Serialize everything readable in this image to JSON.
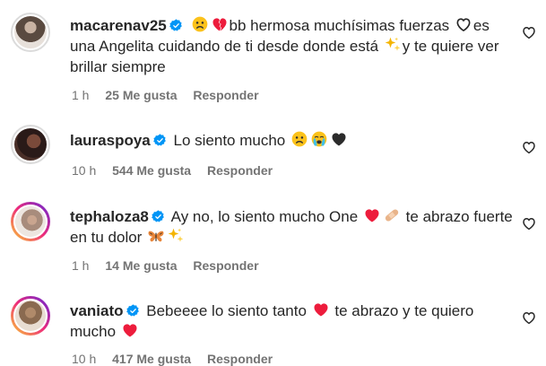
{
  "comments": [
    {
      "username": "macarenav25",
      "text_parts": [
        "bb hermosa muchísimas fuerzas",
        "es una Angelita cuidando de ti desde donde está",
        "y te quiere ver brillar siempre"
      ],
      "time": "1 h",
      "likes": "25 Me gusta",
      "reply": "Responder"
    },
    {
      "username": "lauraspoya",
      "text_parts": [
        "Lo siento mucho"
      ],
      "time": "10 h",
      "likes": "544 Me gusta",
      "reply": "Responder"
    },
    {
      "username": "tephaloza8",
      "text_parts": [
        "Ay no, lo siento mucho One",
        "te abrazo fuerte en tu dolor"
      ],
      "time": "1 h",
      "likes": "14 Me gusta",
      "reply": "Responder"
    },
    {
      "username": "vaniato",
      "text_parts": [
        "Bebeeee lo siento tanto",
        "te abrazo y te quiero mucho"
      ],
      "time": "10 h",
      "likes": "417 Me gusta",
      "reply": "Responder"
    }
  ],
  "colors": {
    "verified": "#0095f6",
    "text": "#262626",
    "meta": "#737373",
    "heart_red": "#ed1c3c"
  }
}
